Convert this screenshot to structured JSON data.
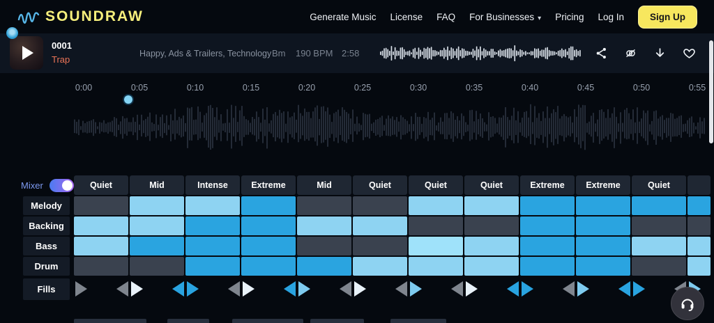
{
  "header": {
    "logo_text": "SOUNDRAW",
    "nav_items": [
      "Generate Music",
      "License",
      "FAQ",
      "For Businesses",
      "Pricing",
      "Log In"
    ],
    "dropdown_item": "For Businesses",
    "signup_label": "Sign Up"
  },
  "player": {
    "track_number": "0001",
    "genre": "Trap",
    "tags": "Happy, Ads & Trailers, Technology",
    "key": "Bm",
    "bpm": "190 BPM",
    "duration": "2:58",
    "icons": [
      "share-icon",
      "copyright-free-icon",
      "download-icon",
      "favorite-icon"
    ]
  },
  "timeline": {
    "labels": [
      "0:00",
      "0:05",
      "0:10",
      "0:15",
      "0:20",
      "0:25",
      "0:30",
      "0:35",
      "0:40",
      "0:45",
      "0:50",
      "0:55"
    ],
    "playhead_position": "0:05"
  },
  "mixer": {
    "toggle_label": "Mixer",
    "toggle_on": true,
    "energy_labels": [
      "Quiet",
      "Mid",
      "Intense",
      "Extreme",
      "Mid",
      "Quiet",
      "Quiet",
      "Quiet",
      "Extreme",
      "Extreme",
      "Quiet",
      ""
    ],
    "row_labels": [
      "Melody",
      "Backing",
      "Bass",
      "Drum",
      "Fills"
    ],
    "grid": {
      "Melody": [
        "dark",
        "light",
        "light",
        "mid",
        "dark",
        "dark",
        "light",
        "light",
        "mid",
        "mid",
        "mid",
        "mid"
      ],
      "Backing": [
        "light",
        "light",
        "mid",
        "mid",
        "light",
        "light",
        "dark",
        "dark",
        "mid",
        "mid",
        "dark",
        "dark"
      ],
      "Bass": [
        "light",
        "mid",
        "mid",
        "mid",
        "dark",
        "dark",
        "xlight",
        "light",
        "mid",
        "mid",
        "light",
        "light"
      ],
      "Drum": [
        "dark",
        "dark",
        "mid",
        "mid",
        "mid",
        "light",
        "light",
        "light",
        "mid",
        "mid",
        "dark",
        "light"
      ]
    },
    "fills": [
      {
        "left": null,
        "right": "gray"
      },
      {
        "left": "gray",
        "right": "white"
      },
      {
        "left": "blue",
        "right": "blue"
      },
      {
        "left": "gray",
        "right": "white"
      },
      {
        "left": "blue",
        "right": "lightblue"
      },
      {
        "left": "gray",
        "right": "white"
      },
      {
        "left": "gray",
        "right": "lightblue"
      },
      {
        "left": "gray",
        "right": "white"
      },
      {
        "left": "blue",
        "right": "blue"
      },
      {
        "left": "gray",
        "right": "lightblue"
      },
      {
        "left": "blue",
        "right": "blue"
      },
      {
        "left": "gray",
        "right": "lightblue"
      }
    ]
  },
  "colors": {
    "cell_dark": "#3a424f",
    "cell_light": "#8ed3f2",
    "cell_xlight": "#9fe2fa",
    "cell_mid": "#2aa4e0",
    "fill_gray": "#7f858e",
    "fill_white": "#e9f2f9",
    "fill_blue": "#29a3e0",
    "fill_lightblue": "#7ecbef",
    "accent_yellow": "#f7e75e",
    "genre_orange": "#ec7457"
  }
}
